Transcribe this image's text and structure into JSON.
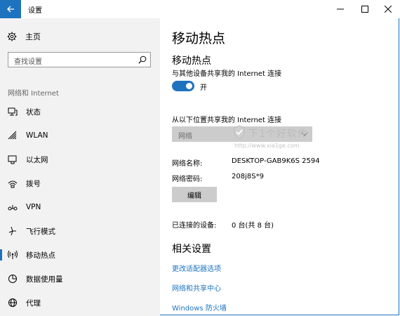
{
  "window": {
    "title": "设置"
  },
  "sidebar": {
    "home_label": "主页",
    "search_placeholder": "查找设置",
    "section_title": "网络和 Internet",
    "items": [
      {
        "label": "状态",
        "icon": "status-icon"
      },
      {
        "label": "WLAN",
        "icon": "wifi-icon"
      },
      {
        "label": "以太网",
        "icon": "ethernet-icon"
      },
      {
        "label": "拨号",
        "icon": "dialup-icon"
      },
      {
        "label": "VPN",
        "icon": "vpn-icon"
      },
      {
        "label": "飞行模式",
        "icon": "airplane-icon"
      },
      {
        "label": "移动热点",
        "icon": "hotspot-icon",
        "active": true
      },
      {
        "label": "数据使用量",
        "icon": "data-usage-icon"
      },
      {
        "label": "代理",
        "icon": "proxy-icon"
      }
    ]
  },
  "main": {
    "page_title": "移动热点",
    "hotspot_heading": "移动热点",
    "share_desc": "与其他设备共享我的 Internet 连接",
    "toggle_state": "开",
    "share_from_label": "从以下位置共享我的 Internet 连接",
    "share_from_value": "网络",
    "network_name_label": "网络名称:",
    "network_name_value": "DESKTOP-GAB9K6S 2594",
    "network_password_label": "网络密码:",
    "network_password_value": "208j8S*9",
    "edit_button": "编辑",
    "connected_label": "已连接的设备:",
    "connected_value": "0 台(共 8 台)",
    "related_heading": "相关设置",
    "links": [
      "更改适配器选项",
      "网络和共享中心",
      "Windows 防火墙"
    ]
  },
  "watermark": {
    "text": "下1个好软件",
    "url": "http://www.xia1ge.com"
  },
  "colors": {
    "accent": "#1e73be",
    "sidebar_bg": "#f2f2f2",
    "button_bg": "#cccccc"
  }
}
